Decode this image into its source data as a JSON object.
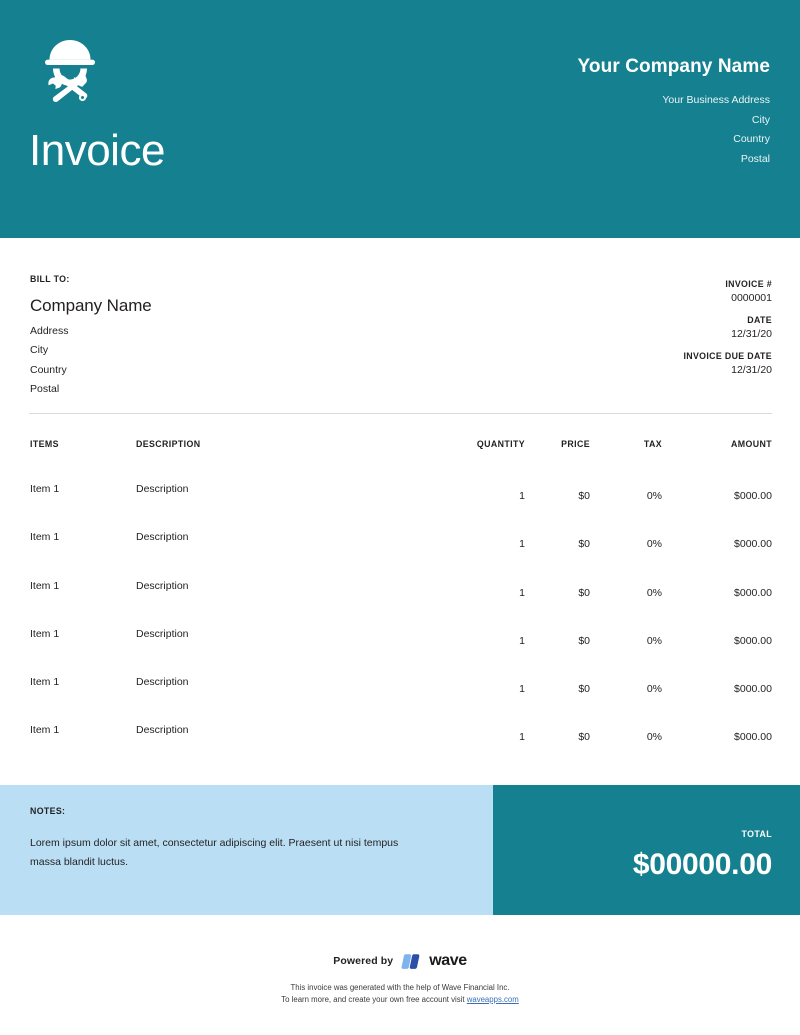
{
  "colors": {
    "brand_teal": "#15808F",
    "notes_blue": "#BADEF4",
    "text_dark": "#231f20",
    "link_blue": "#3b6fb5",
    "wave_light": "#7FB3F0",
    "wave_dark": "#2B4FA8"
  },
  "header": {
    "logo_icon": "construction-worker-hardhat-tools-icon",
    "title": "Invoice",
    "company_name": "Your Company Name",
    "address_lines": [
      "Your Business Address",
      "City",
      "Country",
      "Postal"
    ]
  },
  "bill_to": {
    "label": "BILL TO:",
    "company": "Company Name",
    "lines": [
      "Address",
      "City",
      "Country",
      "Postal"
    ]
  },
  "meta": {
    "invoice_number_label": "INVOICE #",
    "invoice_number": "0000001",
    "date_label": "DATE",
    "date": "12/31/20",
    "due_date_label": "INVOICE DUE DATE",
    "due_date": "12/31/20"
  },
  "table": {
    "headers": {
      "items": "ITEMS",
      "description": "DESCRIPTION",
      "quantity": "QUANTITY",
      "price": "PRICE",
      "tax": "TAX",
      "amount": "AMOUNT"
    },
    "rows": [
      {
        "item": "Item 1",
        "description": "Description",
        "quantity": "1",
        "price": "$0",
        "tax": "0%",
        "amount": "$000.00"
      },
      {
        "item": "Item 1",
        "description": "Description",
        "quantity": "1",
        "price": "$0",
        "tax": "0%",
        "amount": "$000.00"
      },
      {
        "item": "Item 1",
        "description": "Description",
        "quantity": "1",
        "price": "$0",
        "tax": "0%",
        "amount": "$000.00"
      },
      {
        "item": "Item 1",
        "description": "Description",
        "quantity": "1",
        "price": "$0",
        "tax": "0%",
        "amount": "$000.00"
      },
      {
        "item": "Item 1",
        "description": "Description",
        "quantity": "1",
        "price": "$0",
        "tax": "0%",
        "amount": "$000.00"
      },
      {
        "item": "Item 1",
        "description": "Description",
        "quantity": "1",
        "price": "$0",
        "tax": "0%",
        "amount": "$000.00"
      }
    ]
  },
  "notes": {
    "label": "NOTES:",
    "text": "Lorem ipsum dolor sit amet, consectetur adipiscing elit. Praesent ut nisi tempus massa blandit luctus."
  },
  "total": {
    "label": "TOTAL",
    "amount": "$00000.00"
  },
  "footer": {
    "powered_by": "Powered by",
    "wave_wordmark": "wave",
    "wave_logo_icon": "wave-logo-icon",
    "disclaimer_line1": "This invoice was generated with the help of Wave Financial Inc.",
    "disclaimer_line2_prefix": "To learn more, and create your own free account visit ",
    "disclaimer_link": "waveapps.com"
  }
}
